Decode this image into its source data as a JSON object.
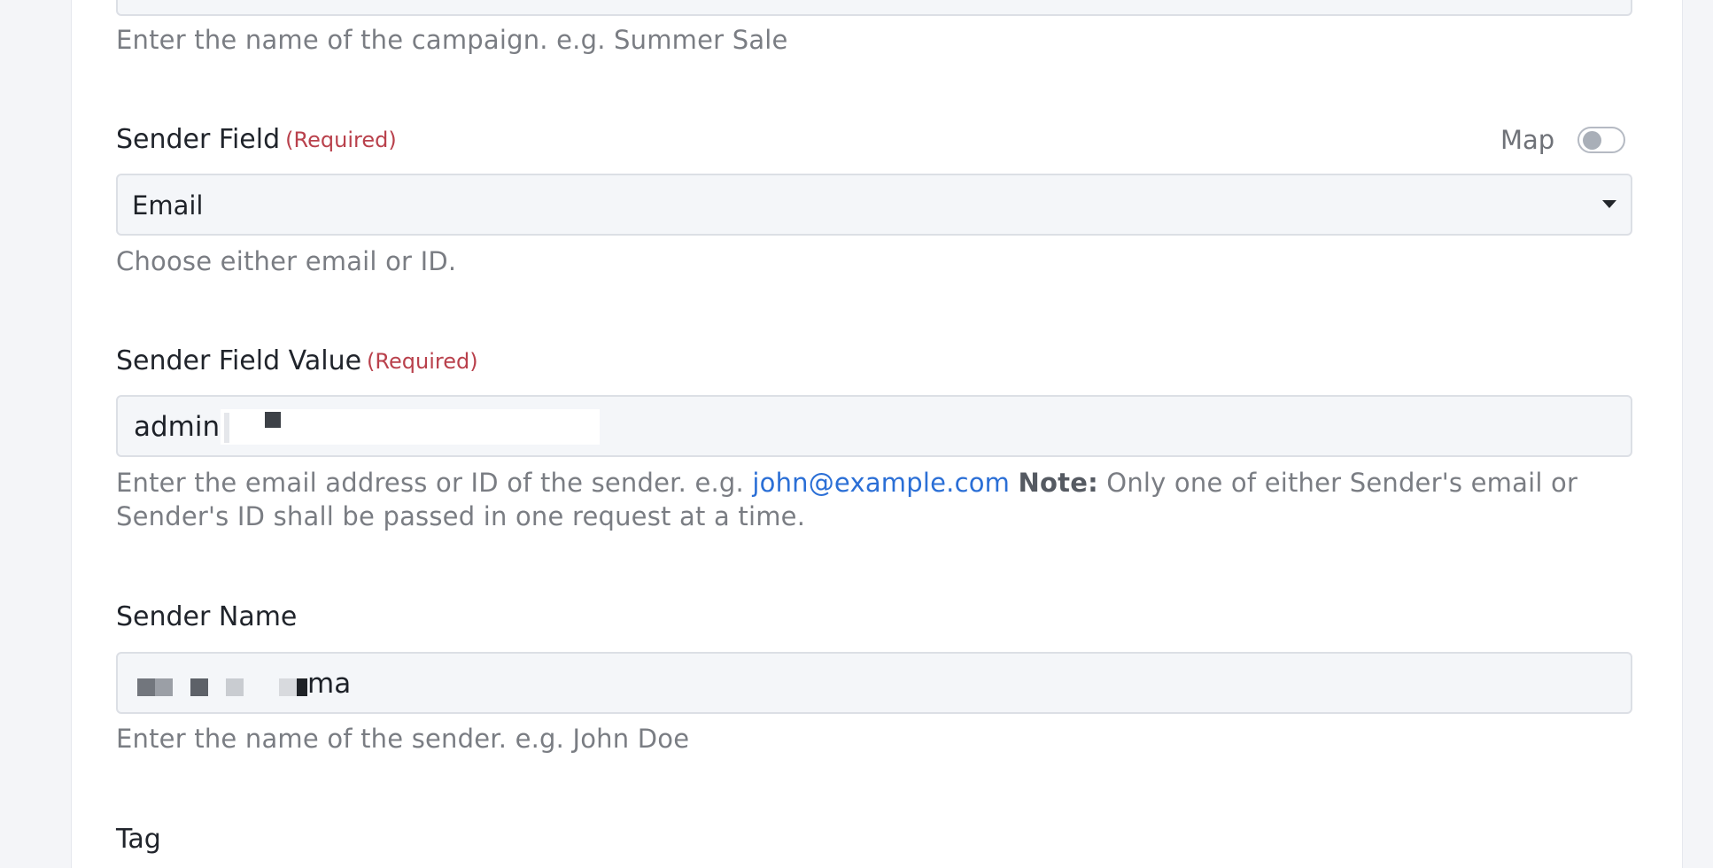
{
  "campaign_name": {
    "help": "Enter the name of the campaign. e.g. Summer Sale"
  },
  "sender_field": {
    "label": "Sender Field",
    "required": "(Required)",
    "map_label": "Map",
    "value": "Email",
    "help": "Choose either email or ID."
  },
  "sender_field_value": {
    "label": "Sender Field Value",
    "required": "(Required)",
    "value_visible": "admin(",
    "help_prefix": "Enter the email address or ID of the sender. e.g. ",
    "help_link": "john@example.com",
    "help_note_label": "Note:",
    "help_note_text": " Only one of either Sender's email or Sender's ID shall be passed in one request at a time."
  },
  "sender_name": {
    "label": "Sender Name",
    "value_visible": "ma",
    "help": "Enter the name of the sender. e.g. John Doe"
  },
  "tag": {
    "label": "Tag"
  },
  "icons": {
    "select_caret": "caret-down-icon",
    "map_toggle": "toggle-switch-icon"
  },
  "colors": {
    "required": "#b9414c",
    "link": "#2b6fd6",
    "input_bg": "#f4f6f9",
    "input_border": "#dcdfe5"
  }
}
